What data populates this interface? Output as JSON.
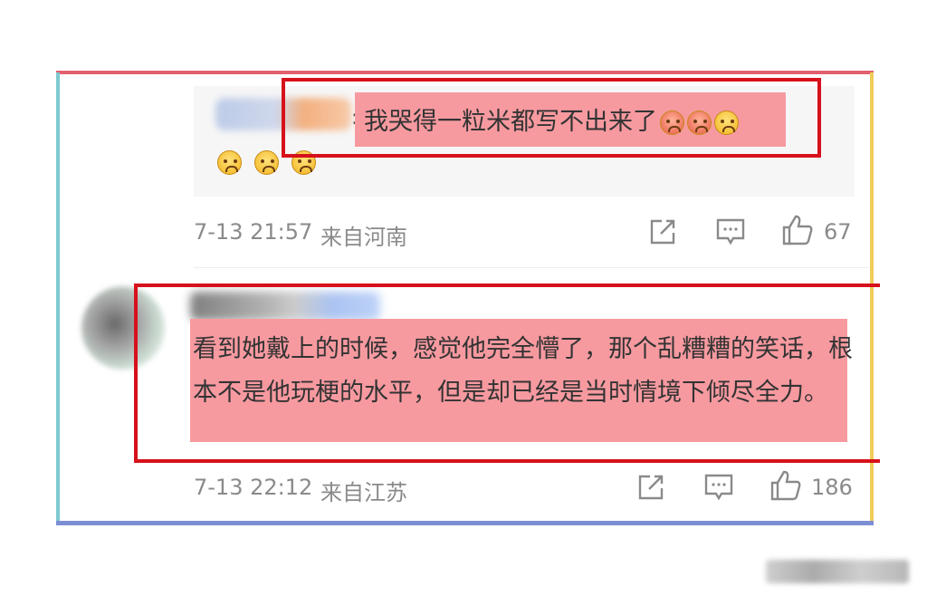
{
  "quoted_reply": {
    "text": "我哭得一粒米都写不出来了",
    "colon": ":",
    "emojis_inline": [
      "angry-face",
      "angry-face",
      "crying-face"
    ],
    "emojis_second_row": [
      "crying-face",
      "crying-face",
      "crying-face"
    ]
  },
  "comment1_meta": {
    "time": "7-13 21:57",
    "location": "来自河南",
    "like_count": "67"
  },
  "comment2": {
    "text": "看到她戴上的时候，感觉他完全懵了，那个乱糟糟的笑话，根本不是他玩梗的水平，但是却已经是当时情境下倾尽全力。",
    "time": "7-13 22:12",
    "location": "来自江苏",
    "like_count": "186"
  },
  "icons": {
    "share": "share-icon",
    "comment": "comment-icon",
    "like": "thumbs-up-icon"
  },
  "colors": {
    "highlight": "#f79aa0",
    "box_border": "#d6111b",
    "frame_top": "#e3606e",
    "frame_left": "#7fc9d0",
    "frame_right": "#f0cd58",
    "frame_bottom": "#7c8fd4"
  }
}
